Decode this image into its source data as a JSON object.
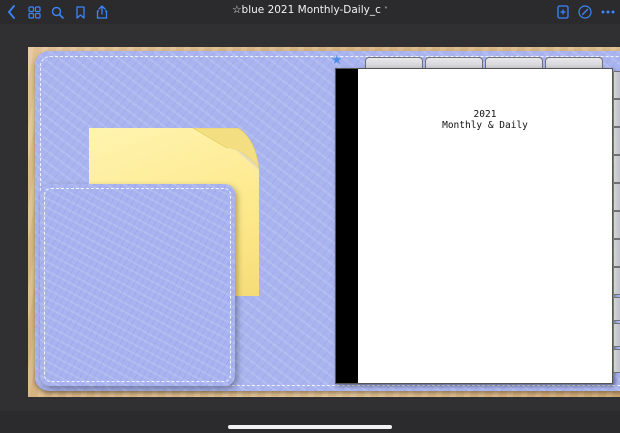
{
  "toolbar": {
    "title": "☆blue 2021 Monthly-Daily_c",
    "title_chevron": "˅",
    "left_icons": [
      "back-chevron-icon",
      "grid-icon",
      "search-icon",
      "bookmark-icon",
      "share-icon"
    ],
    "right_icons": [
      "add-page-icon",
      "pen-icon",
      "more-icon"
    ]
  },
  "page": {
    "year": "2021",
    "subtitle": "Monthly & Daily"
  },
  "colors": {
    "accent": "#3a86ff",
    "cover": "#aab5ef",
    "sticky_note": "#fde98c",
    "background": "#2b2b2d"
  },
  "decoration": {
    "star": "★"
  }
}
